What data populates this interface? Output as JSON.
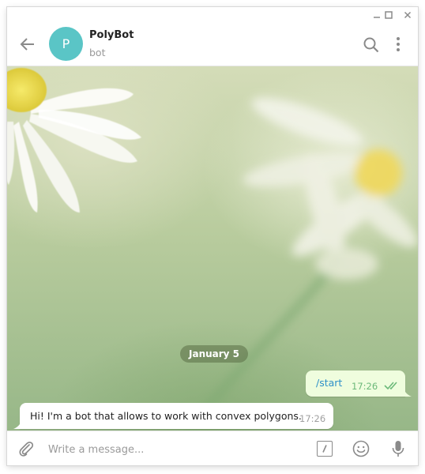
{
  "window": {
    "controls": {
      "minimize_icon": "minimize-icon",
      "maximize_icon": "maximize-icon",
      "close_icon": "close-icon"
    }
  },
  "header": {
    "avatar_letter": "P",
    "avatar_color": "#5ac5c6",
    "chat_name": "PolyBot",
    "chat_status": "bot",
    "icons": [
      "back-arrow-icon",
      "search-icon",
      "more-vertical-icon"
    ]
  },
  "chat": {
    "date_separator": "January 5",
    "messages": [
      {
        "direction": "out",
        "text": "/start",
        "time": "17:26",
        "status": "read"
      },
      {
        "direction": "in",
        "text": "Hi! I'm a bot that allows to work with convex polygons.",
        "time": "17:26"
      }
    ]
  },
  "composer": {
    "placeholder": "Write a message...",
    "value": "",
    "icons": [
      "paperclip-icon",
      "bot-command-icon",
      "emoji-icon",
      "microphone-icon"
    ]
  },
  "colors": {
    "outgoing_bubble": "#effdde",
    "incoming_bubble": "#ffffff",
    "link": "#2d90c8",
    "read_check": "#6cb97a"
  }
}
